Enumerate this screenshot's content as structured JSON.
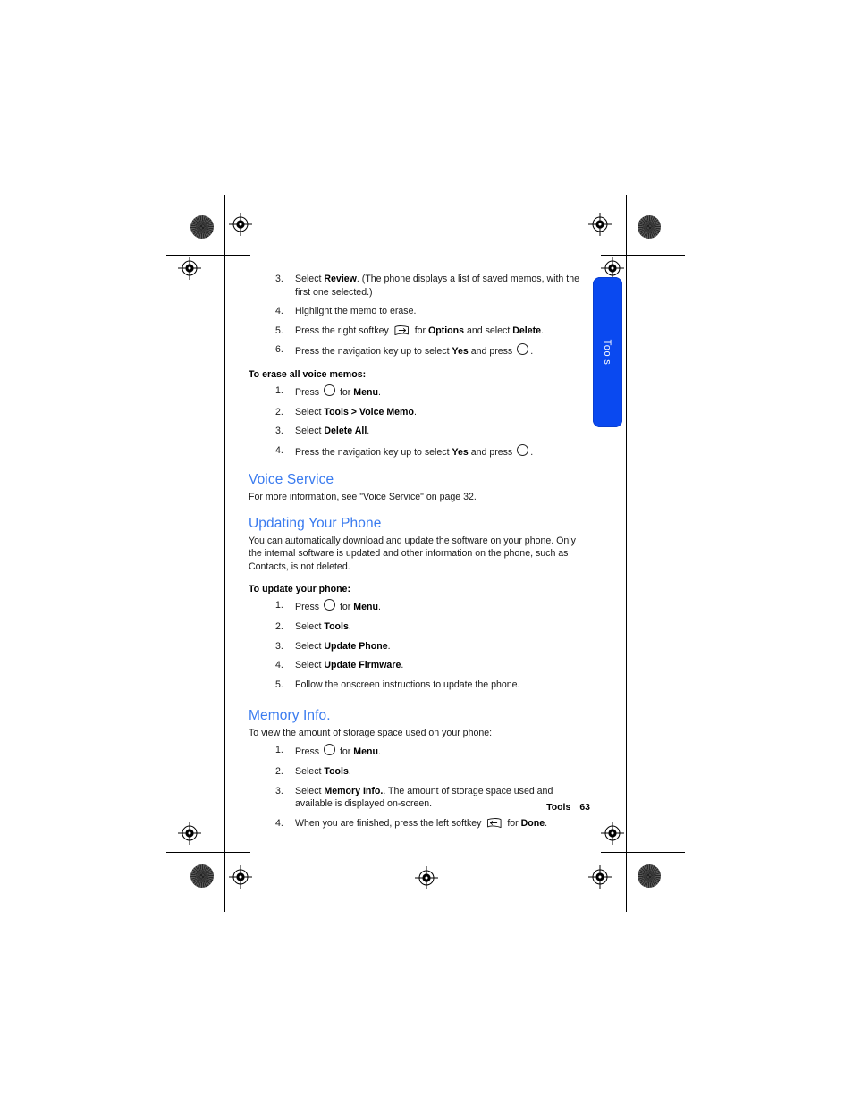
{
  "page": {
    "side_tab_label": "Tools",
    "footer_section": "Tools",
    "footer_page_number": "63",
    "heading_color": "#3a7bef",
    "tab_color": "#0a49f0"
  },
  "erase_memo_steps": {
    "items": [
      {
        "num": "3.",
        "pre": "Select ",
        "bold1": "Review",
        "post": ". (The phone displays a list of saved memos, with the first one selected.)"
      },
      {
        "num": "4.",
        "pre": "Highlight the memo to erase.",
        "bold1": "",
        "post": ""
      },
      {
        "num": "5.",
        "pre": "Press the right softkey ",
        "icon": "right-softkey-icon",
        "mid": " for ",
        "bold1": "Options",
        "mid2": " and select ",
        "bold2": "Delete",
        "post": "."
      },
      {
        "num": "6.",
        "pre": "Press the navigation key up to select ",
        "bold1": "Yes",
        "mid": " and press ",
        "icon": "ok-key-icon",
        "post": "."
      }
    ]
  },
  "erase_all": {
    "subhead": "To erase all voice memos:",
    "items": [
      {
        "num": "1.",
        "pre": "Press ",
        "icon": "ok-key-icon",
        "mid": " for ",
        "bold1": "Menu",
        "post": "."
      },
      {
        "num": "2.",
        "pre": "Select ",
        "bold1": "Tools > Voice Memo",
        "post": "."
      },
      {
        "num": "3.",
        "pre": "Select ",
        "bold1": "Delete All",
        "post": "."
      },
      {
        "num": "4.",
        "pre": "Press the navigation key up to select ",
        "bold1": "Yes",
        "mid": " and press ",
        "icon": "ok-key-icon",
        "post": "."
      }
    ]
  },
  "voice_service": {
    "heading": "Voice Service",
    "body": "For more information, see \"Voice Service\" on page 32."
  },
  "updating_your_phone": {
    "heading": "Updating Your Phone",
    "body": "You can automatically download and update the software on your phone. Only the internal software is updated and other information on the phone, such as Contacts, is not deleted.",
    "subhead": "To update your phone:",
    "items": [
      {
        "num": "1.",
        "pre": "Press ",
        "icon": "ok-key-icon",
        "mid": " for ",
        "bold1": "Menu",
        "post": "."
      },
      {
        "num": "2.",
        "pre": "Select ",
        "bold1": "Tools",
        "post": "."
      },
      {
        "num": "3.",
        "pre": "Select ",
        "bold1": "Update Phone",
        "post": "."
      },
      {
        "num": "4.",
        "pre": "Select ",
        "bold1": "Update Firmware",
        "post": "."
      },
      {
        "num": "5.",
        "pre": "Follow the onscreen instructions to update the phone.",
        "bold1": "",
        "post": ""
      }
    ]
  },
  "memory_info": {
    "heading": "Memory Info.",
    "body": "To view the amount of storage space used on your phone:",
    "items": [
      {
        "num": "1.",
        "pre": "Press ",
        "icon": "ok-key-icon",
        "mid": " for ",
        "bold1": "Menu",
        "post": "."
      },
      {
        "num": "2.",
        "pre": "Select ",
        "bold1": "Tools",
        "post": "."
      },
      {
        "num": "3.",
        "pre": "Select ",
        "bold1": "Memory Info.",
        "post": ". The amount of storage space used and available is displayed on-screen."
      },
      {
        "num": "4.",
        "pre": "When you are finished, press the left softkey ",
        "icon": "left-softkey-icon",
        "mid": " for ",
        "bold1": "Done",
        "post": "."
      }
    ]
  }
}
